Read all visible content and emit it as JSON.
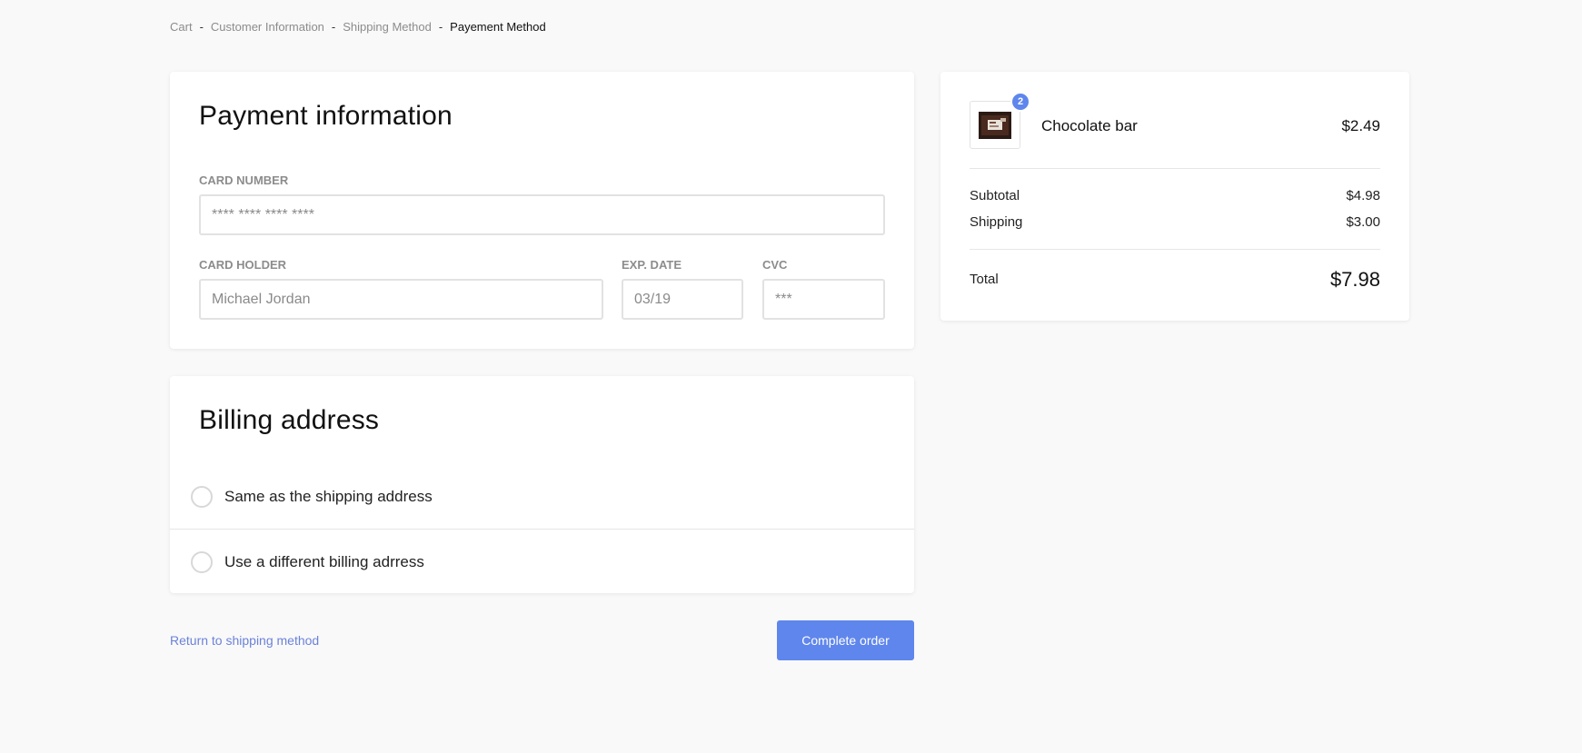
{
  "breadcrumb": {
    "items": [
      {
        "label": "Cart"
      },
      {
        "label": "Customer Information"
      },
      {
        "label": "Shipping Method"
      },
      {
        "label": "Payement Method"
      }
    ],
    "separator": "-"
  },
  "payment": {
    "title": "Payment information",
    "card_number": {
      "label": "CARD NUMBER",
      "placeholder": "**** **** **** ****",
      "value": ""
    },
    "card_holder": {
      "label": "CARD HOLDER",
      "placeholder": "Michael Jordan",
      "value": ""
    },
    "exp_date": {
      "label": "EXP. DATE",
      "placeholder": "03/19",
      "value": ""
    },
    "cvc": {
      "label": "CVC",
      "placeholder": "***",
      "value": ""
    }
  },
  "billing": {
    "title": "Billing address",
    "options": [
      {
        "label": "Same as the shipping address",
        "selected": false
      },
      {
        "label": "Use a different billing adrress",
        "selected": false
      }
    ]
  },
  "actions": {
    "return_label": "Return to shipping method",
    "complete_label": "Complete order"
  },
  "summary": {
    "item": {
      "name": "Chocolate bar",
      "price": "$2.49",
      "quantity": "2",
      "icon": "chocolate-bar-image"
    },
    "subtotal_label": "Subtotal",
    "subtotal_value": "$4.98",
    "shipping_label": "Shipping",
    "shipping_value": "$3.00",
    "total_label": "Total",
    "total_value": "$7.98"
  },
  "colors": {
    "accent": "#5f86ec",
    "link": "#6b82d9",
    "background": "#f9f9f9"
  }
}
